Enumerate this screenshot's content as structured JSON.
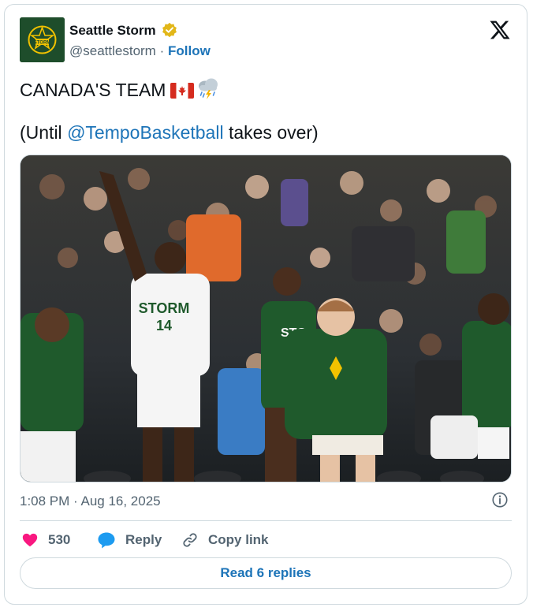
{
  "author": {
    "name": "Seattle Storm",
    "handle": "@seattlestorm",
    "separator": "·",
    "follow_label": "Follow",
    "avatar_icon": "seattle-storm-logo",
    "verified_icon": "gold-verified-badge",
    "brand_color": "#1e4d2b",
    "accent_color": "#f2c200"
  },
  "platform_icon": "x-logo",
  "tweet": {
    "line1_text": "CANADA'S TEAM",
    "line1_icons": [
      "canada-flag-icon",
      "storm-cloud-icon"
    ],
    "line2_prefix": "(Until ",
    "mention": "@TempoBasketball",
    "line2_suffix": " takes over)"
  },
  "media": {
    "icon": "team-celebration-photo"
  },
  "meta": {
    "timestamp": "1:08 PM · Aug 16, 2025",
    "info_icon": "info-icon"
  },
  "actions": {
    "like_count": "530",
    "reply_label": "Reply",
    "copy_link_label": "Copy link",
    "like_color": "#f91880",
    "reply_color": "#1d9bf0"
  },
  "read_replies_label": "Read 6 replies",
  "link_color": "#1d74b8"
}
